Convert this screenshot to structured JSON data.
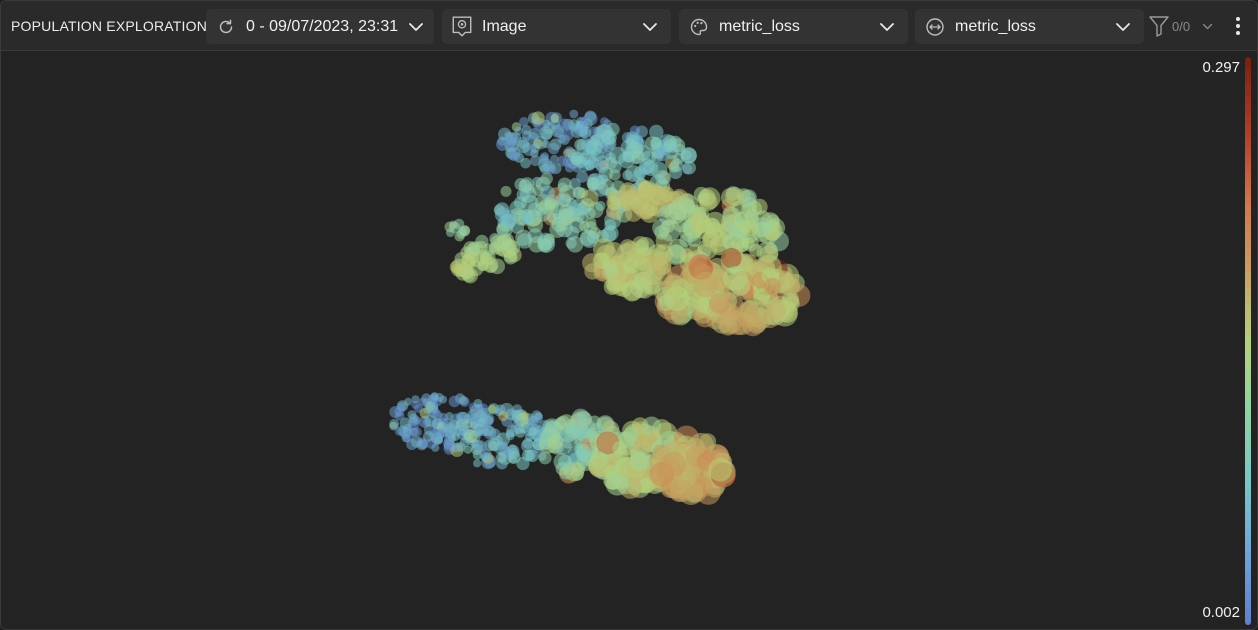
{
  "panel": {
    "title": "POPULATION EXPLORATION"
  },
  "toolbar": {
    "version_selector": {
      "value": "0 - 09/07/2023, 23:31",
      "icon": "refresh-icon"
    },
    "data_selector": {
      "value": "Image",
      "icon": "image-input-icon"
    },
    "color_selector": {
      "value": "metric_loss",
      "icon": "palette-icon"
    },
    "size_selector": {
      "value": "metric_loss",
      "icon": "size-icon"
    },
    "filter": {
      "count": "0/0",
      "icon": "filter-icon"
    },
    "more": {
      "icon": "more-vertical-icon"
    }
  },
  "colorscale": {
    "max_label": "0.297",
    "min_label": "0.002",
    "colors": [
      "#7a1e0e",
      "#d4774a",
      "#b4d27a",
      "#79c8c4",
      "#5f7fd0"
    ]
  },
  "colors": {
    "background": "#232323",
    "toolbar": "#2a2a2a",
    "dropdown": "#333333"
  }
}
